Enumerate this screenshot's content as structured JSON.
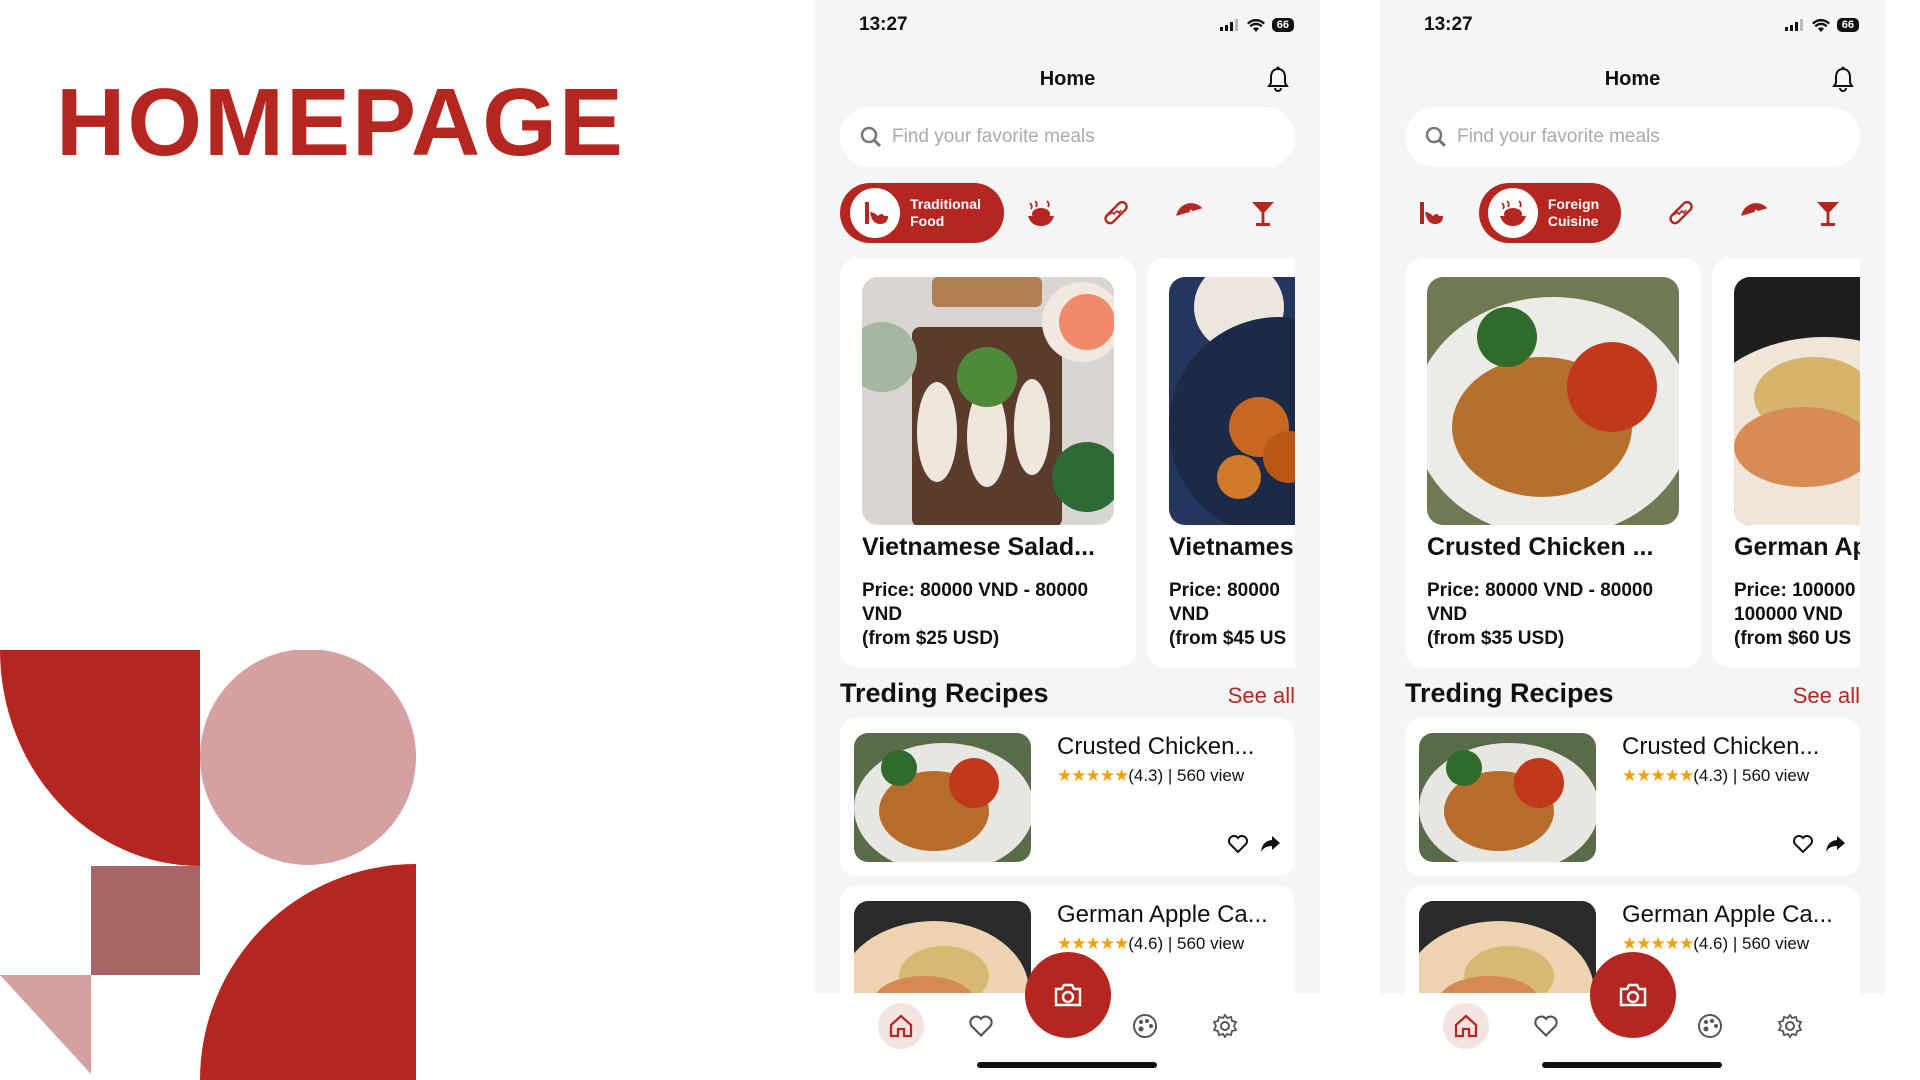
{
  "page": {
    "title": "HOMEPAGE"
  },
  "colors": {
    "brand": "#b4261f",
    "star": "#f2a10b",
    "deco_pink": "#d5a0a0",
    "deco_mauve": "#a86566"
  },
  "status": {
    "time": "13:27",
    "battery": "66"
  },
  "header": {
    "title": "Home"
  },
  "search": {
    "placeholder": "Find your favorite meals"
  },
  "categories": [
    {
      "icon": "bowl-chopsticks-icon",
      "label": "Traditional Food"
    },
    {
      "icon": "roast-chicken-icon",
      "label": "Foreign Cuisine"
    },
    {
      "icon": "hotdog-icon",
      "label": ""
    },
    {
      "icon": "watermelon-icon",
      "label": ""
    },
    {
      "icon": "cocktail-icon",
      "label": ""
    }
  ],
  "screens": [
    {
      "active_category": 0,
      "cards": [
        {
          "title": "Vietnamese Salad...",
          "price_line1": "Price: 80000 VND - 80000",
          "price_line2": "VND",
          "price_line3": "(from $25 USD)"
        },
        {
          "title": "Vietnames",
          "price_line1": "Price: 80000",
          "price_line2": "VND",
          "price_line3": "(from $45 US"
        }
      ]
    },
    {
      "active_category": 1,
      "cards": [
        {
          "title": "Crusted Chicken ...",
          "price_line1": "Price: 80000 VND - 80000",
          "price_line2": "VND",
          "price_line3": "(from $35 USD)"
        },
        {
          "title": "German Ap",
          "price_line1": "Price: 100000",
          "price_line2": "100000 VND",
          "price_line3": "(from $60 US"
        }
      ]
    }
  ],
  "trending": {
    "title": "Treding Recipes",
    "see_all": "See all",
    "items": [
      {
        "name": "Crusted Chicken...",
        "stars": "★★★★★",
        "rating": "(4.3) | 560 view"
      },
      {
        "name": "German Apple Ca...",
        "stars": "★★★★★",
        "rating": "(4.6) | 560 view"
      }
    ]
  },
  "tabbar": {
    "items": [
      "home-icon",
      "heart-icon",
      "camera-icon",
      "palette-icon",
      "settings-icon"
    ]
  }
}
